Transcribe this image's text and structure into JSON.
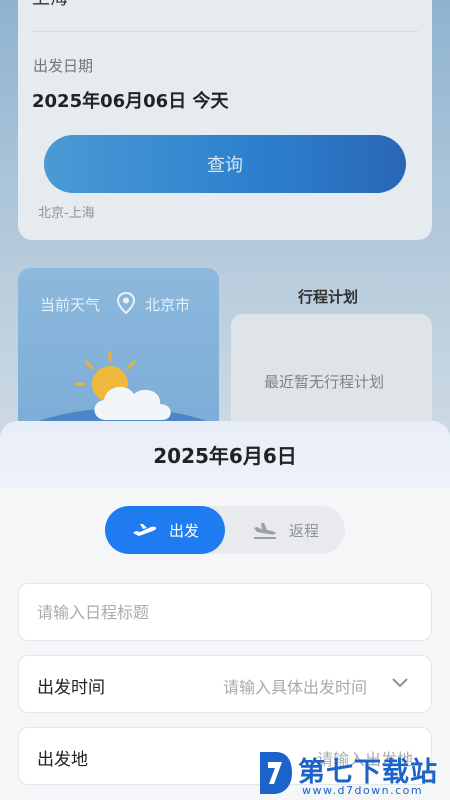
{
  "background": {
    "search": {
      "destination": "上海",
      "date_label": "出发日期",
      "date_value": "2025年06月06日 今天",
      "query_button": "查询",
      "route_hint": "北京-上海"
    },
    "weather": {
      "title": "当前天气",
      "city": "北京市",
      "icon": "partly-cloudy-icon"
    },
    "plan": {
      "title": "行程计划",
      "empty_text": "最近暂无行程计划"
    }
  },
  "sheet": {
    "title": "2025年6月6日",
    "toggle": {
      "depart": "出发",
      "return": "返程",
      "active": "depart"
    },
    "schedule_title": {
      "placeholder": "请输入日程标题"
    },
    "depart_time": {
      "label": "出发时间",
      "placeholder": "请输入具体出发时间"
    },
    "depart_place": {
      "label": "出发地",
      "placeholder": "请输入出发地"
    }
  },
  "watermark": {
    "brand": "第七下载站",
    "url": "www.d7down.com"
  },
  "colors": {
    "accent": "#1f7bf0",
    "sheet_header": "#e8eef8",
    "weather_card": "#8cb8dc",
    "query_button": "#2c7fcd"
  }
}
